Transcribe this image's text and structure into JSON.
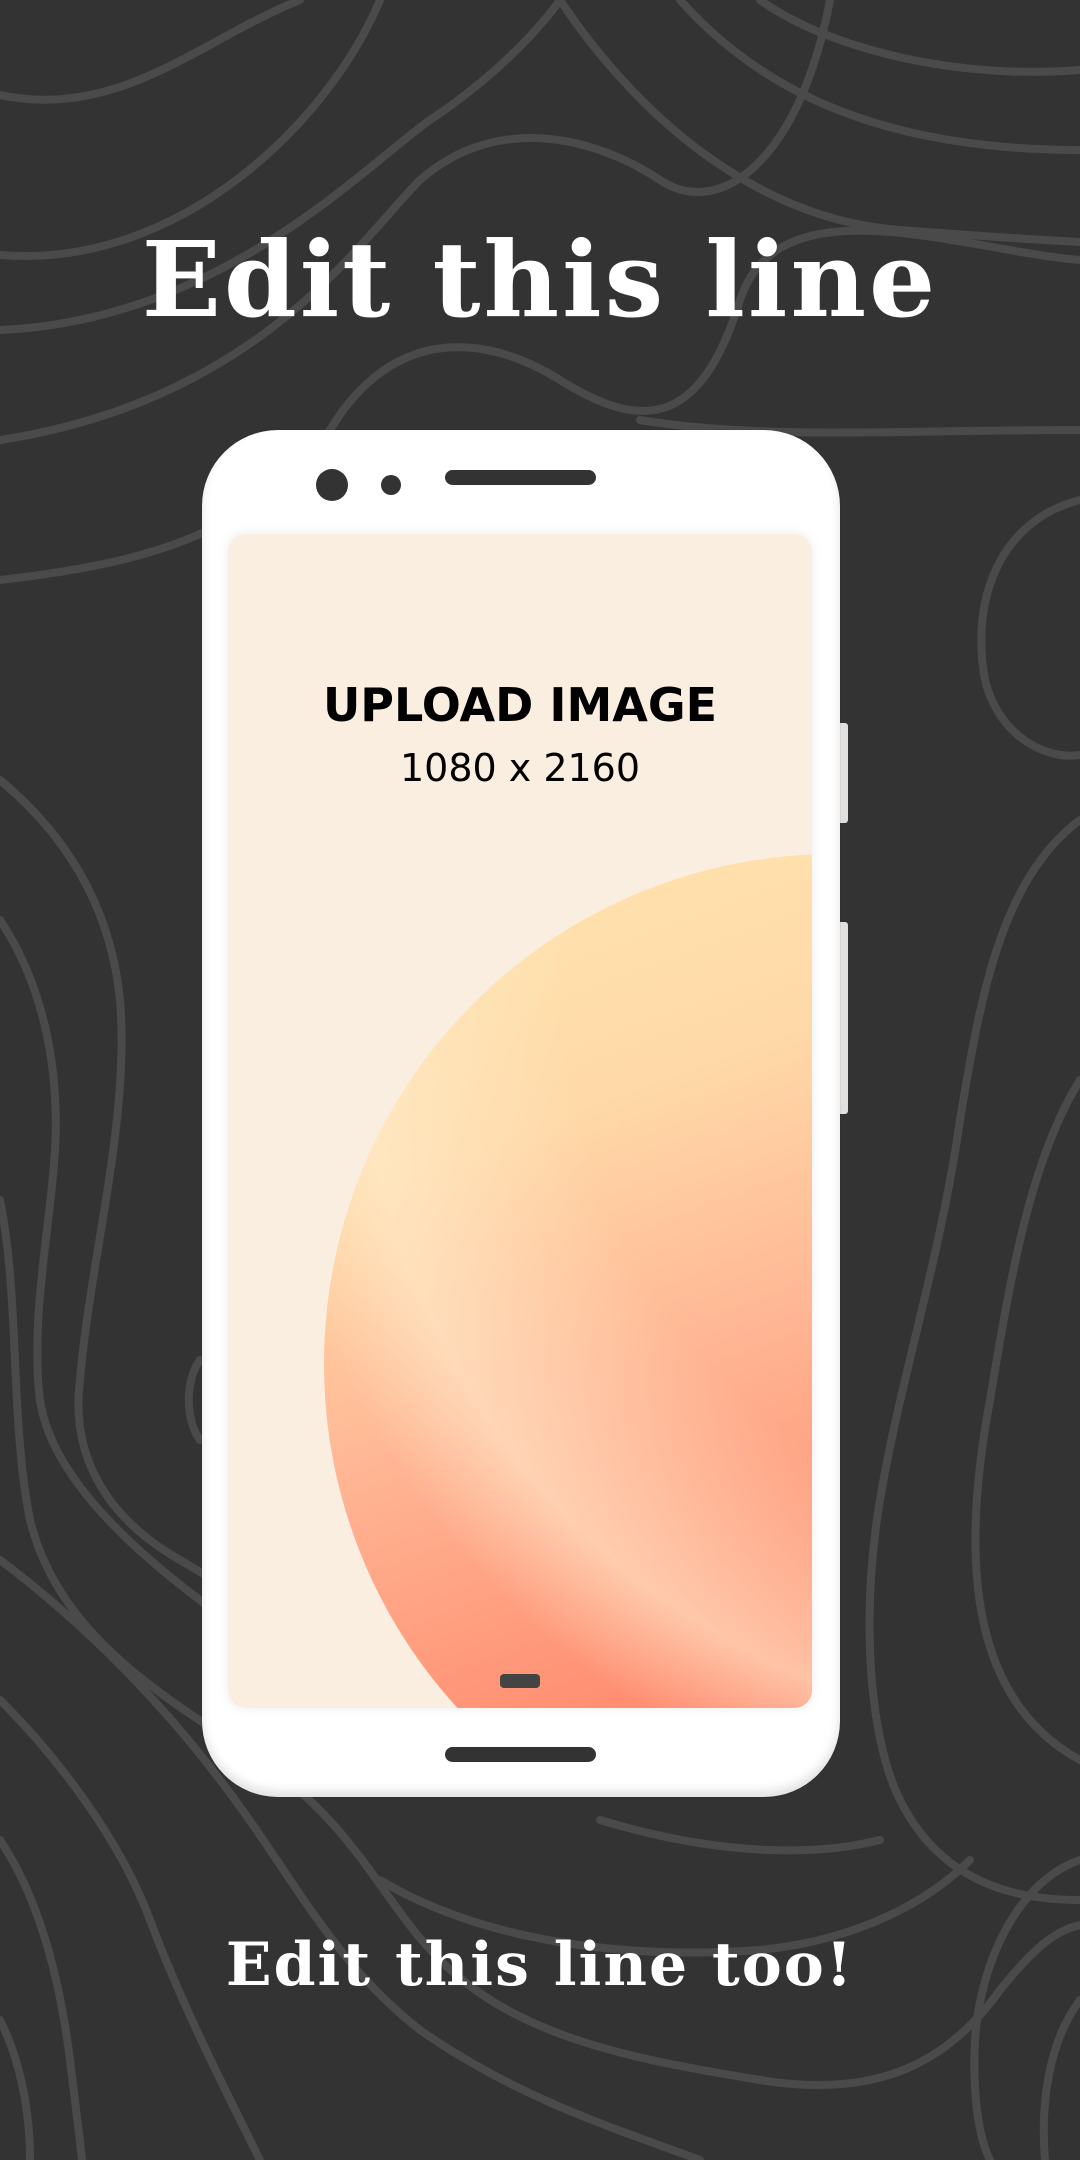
{
  "headline": "Edit this line",
  "subline": "Edit this line too!",
  "phone": {
    "upload_title": "UPLOAD IMAGE",
    "upload_size": "1080 x 2160"
  },
  "colors": {
    "background": "#333333",
    "contour_lines": "#4a4a4a",
    "phone_body": "#ffffff",
    "screen_background": "#faeee0",
    "gradient_start": "#ffe6b0",
    "gradient_end": "#ff6a55",
    "text_light": "#ffffff",
    "text_dark": "#000000"
  },
  "icons": [
    "front-camera-icon",
    "sensor-icon",
    "earpiece-speaker-icon",
    "bottom-speaker-icon",
    "home-indicator-icon"
  ]
}
